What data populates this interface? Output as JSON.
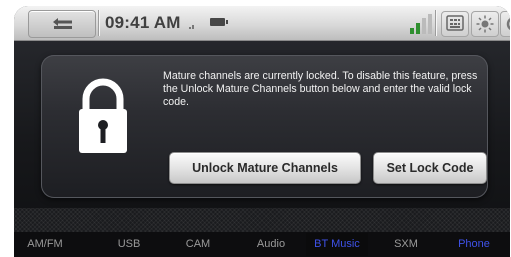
{
  "status_bar": {
    "time": "09:41 AM",
    "icons": [
      "back-arrow-icon",
      "battery-icon",
      "signal-icon",
      "keypad-icon",
      "brightness-icon",
      "settings-icon"
    ]
  },
  "dialog": {
    "icon": "padlock-icon",
    "message": "Mature channels are currently locked. To disable this feature, press the Unlock Mature Channels button below and enter the valid lock code.",
    "unlock_button_label": "Unlock Mature Channels",
    "set_lock_button_label": "Set Lock Code"
  },
  "bottom_nav": {
    "tabs": [
      {
        "label": "AM/FM"
      },
      {
        "label": "USB"
      },
      {
        "label": "CAM"
      },
      {
        "label": "Audio"
      },
      {
        "label": "BT Music"
      },
      {
        "label": "SXM"
      },
      {
        "label": "Phone"
      }
    ]
  },
  "colors": {
    "active_tab": "#3f52e8",
    "inactive_tab": "#9a9a9a",
    "dialog_bg": "#2c2d32"
  }
}
